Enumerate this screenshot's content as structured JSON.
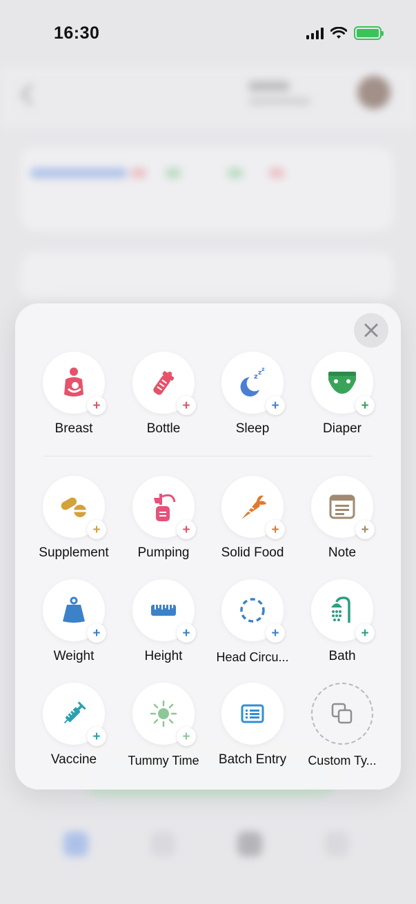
{
  "status_bar": {
    "time": "16:30"
  },
  "panel": {
    "primary": [
      {
        "name": "breast",
        "label": "Breast",
        "icon": "breastfeeding-icon",
        "plus_color": "#e5526a"
      },
      {
        "name": "bottle",
        "label": "Bottle",
        "icon": "baby-bottle-icon",
        "plus_color": "#e5526a"
      },
      {
        "name": "sleep",
        "label": "Sleep",
        "icon": "moon-sleep-icon",
        "plus_color": "#4a7fd4"
      },
      {
        "name": "diaper",
        "label": "Diaper",
        "icon": "diaper-icon",
        "plus_color": "#3aa35a"
      }
    ],
    "secondary": [
      {
        "name": "supplement",
        "label": "Supplement",
        "icon": "pills-icon",
        "plus_color": "#d4a23a"
      },
      {
        "name": "pumping",
        "label": "Pumping",
        "icon": "breast-pump-icon",
        "plus_color": "#e5526a"
      },
      {
        "name": "solid-food",
        "label": "Solid Food",
        "icon": "carrot-icon",
        "plus_color": "#e07a2f"
      },
      {
        "name": "note",
        "label": "Note",
        "icon": "note-icon",
        "plus_color": "#a08a72"
      },
      {
        "name": "weight",
        "label": "Weight",
        "icon": "weight-icon",
        "plus_color": "#3b82c8"
      },
      {
        "name": "height",
        "label": "Height",
        "icon": "ruler-icon",
        "plus_color": "#3b82c8"
      },
      {
        "name": "head-circumference",
        "label": "Head Circu...",
        "icon": "head-circle-icon",
        "plus_color": "#3b82c8"
      },
      {
        "name": "bath",
        "label": "Bath",
        "icon": "shower-icon",
        "plus_color": "#2aa080"
      },
      {
        "name": "vaccine",
        "label": "Vaccine",
        "icon": "syringe-icon",
        "plus_color": "#2aa0b0"
      },
      {
        "name": "tummy-time",
        "label": "Tummy Time",
        "icon": "sun-icon",
        "plus_color": "#8cc796"
      },
      {
        "name": "batch-entry",
        "label": "Batch Entry",
        "icon": "list-icon",
        "plus_color": ""
      },
      {
        "name": "custom-type",
        "label": "Custom Ty...",
        "icon": "copy-squares-icon",
        "plus_color": ""
      }
    ]
  }
}
